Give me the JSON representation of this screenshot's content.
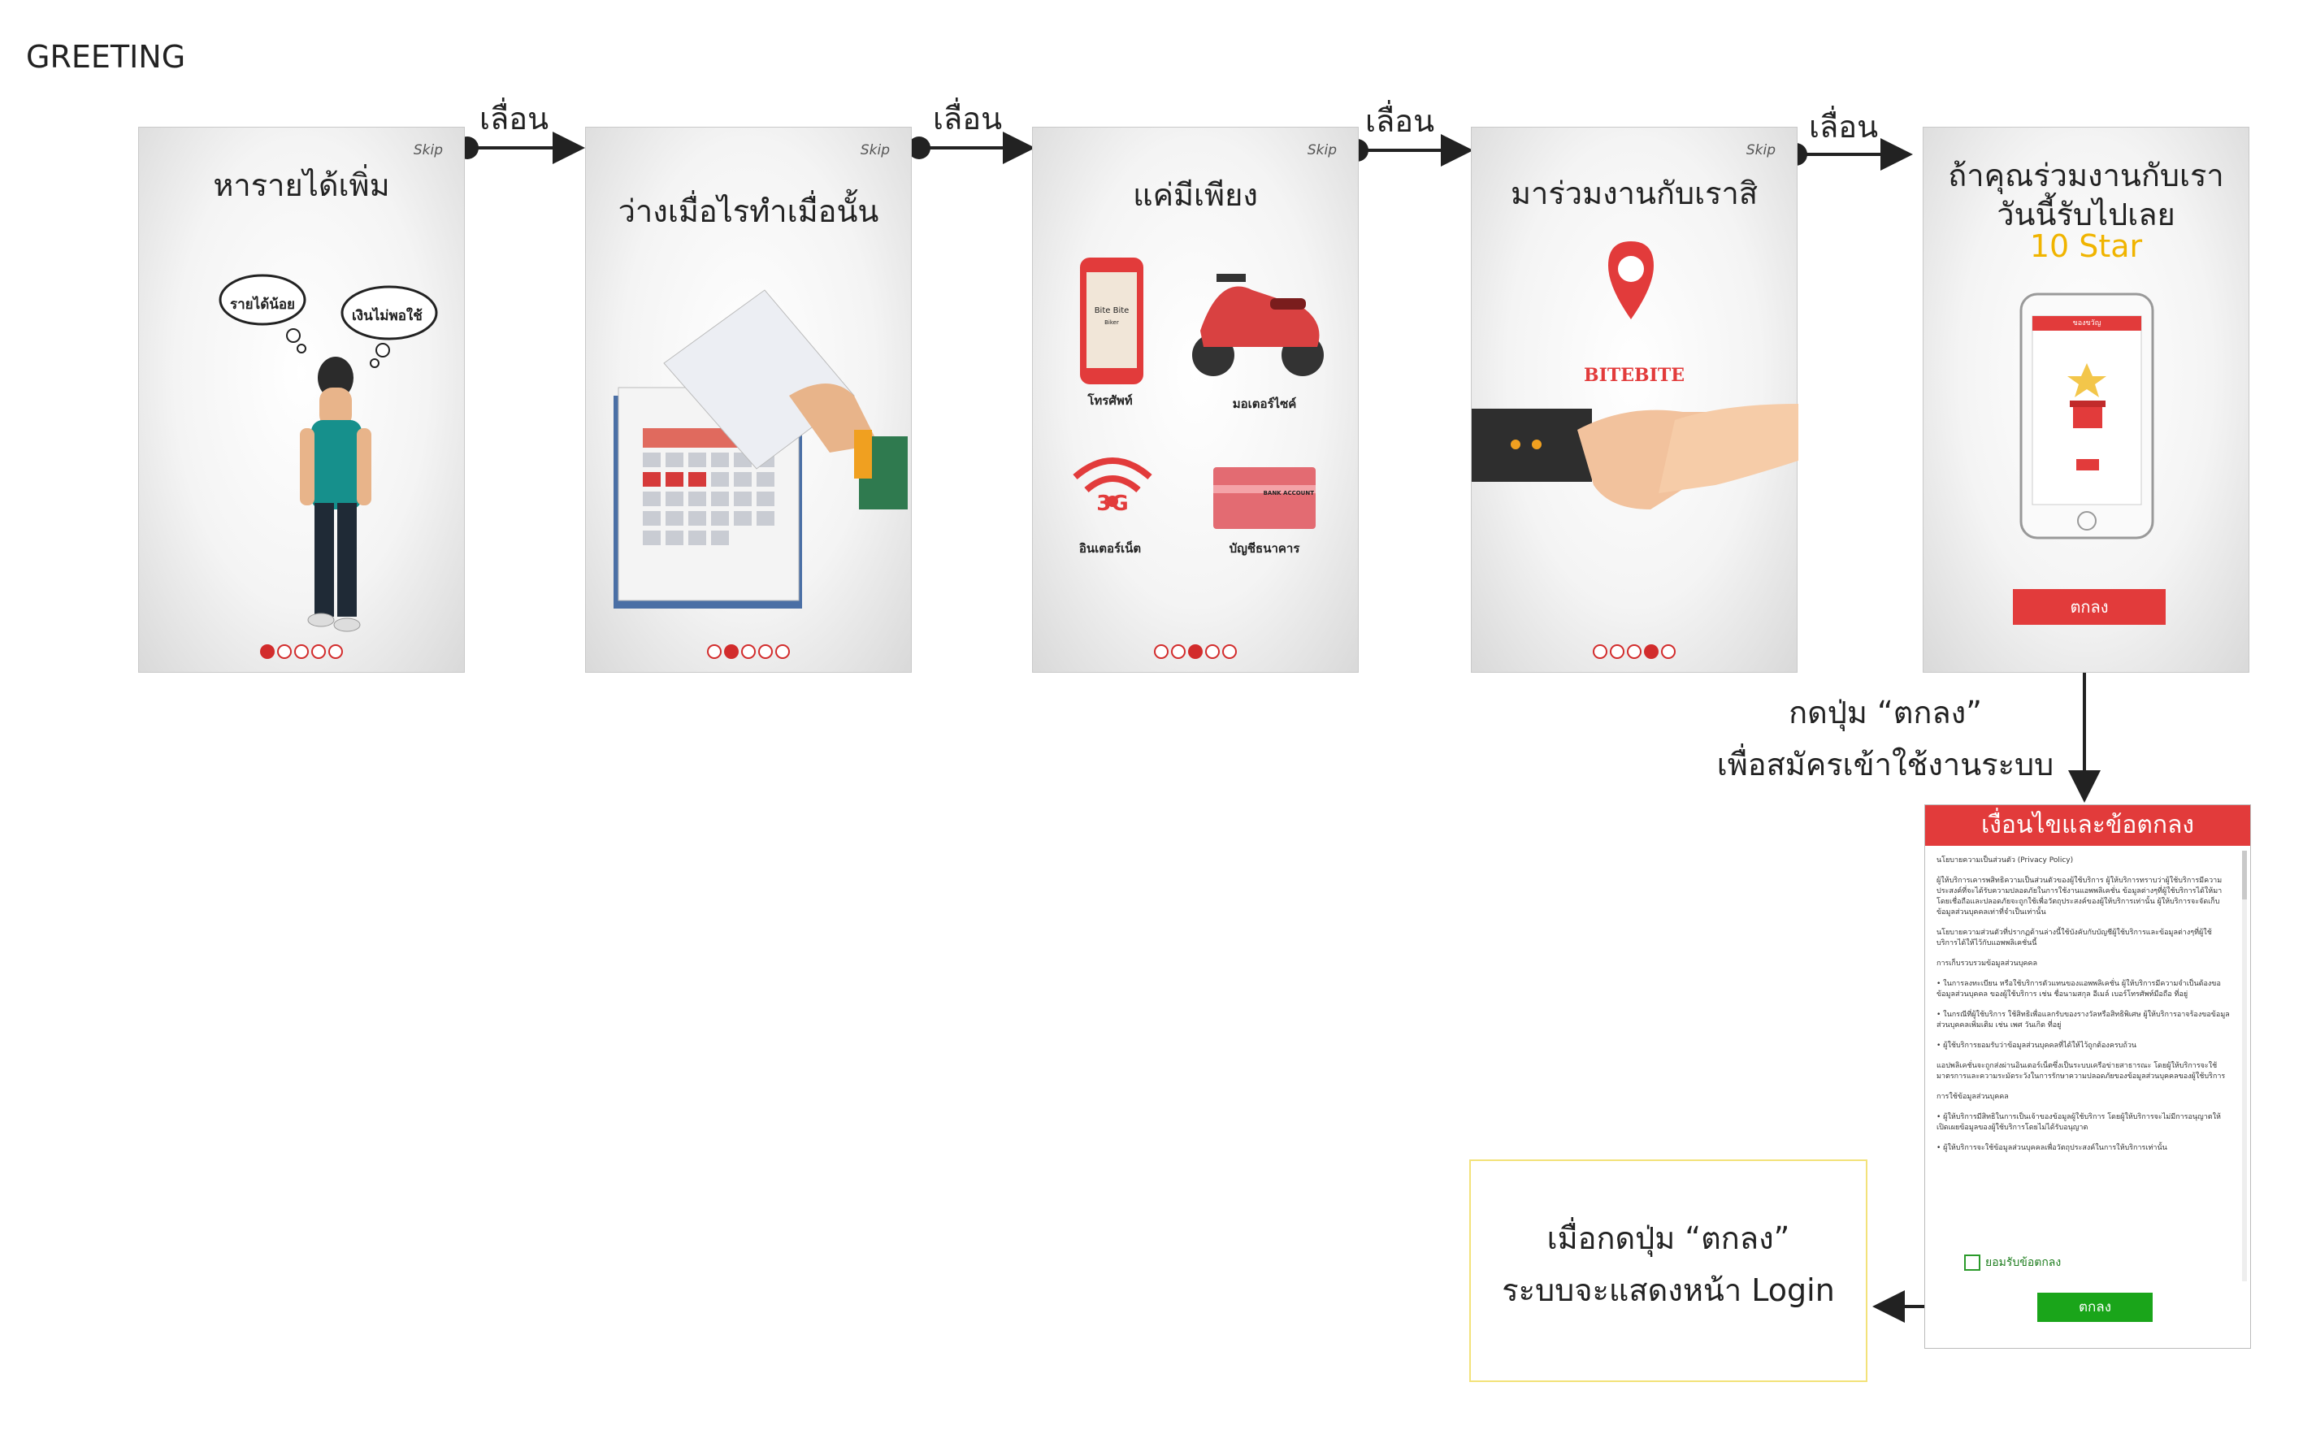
{
  "page_title": "GREETING",
  "swipe_label": "เลื่อน",
  "skip_label": "Skip",
  "screens": [
    {
      "title": "หารายได้เพิ่ม",
      "bubbles": [
        "รายได้น้อย",
        "เงินไม่พอใช้"
      ]
    },
    {
      "title": "ว่างเมื่อไรทำเมื่อนั้น"
    },
    {
      "title": "แค่มีเพียง",
      "items": [
        "โทรศัพท์",
        "มอเตอร์ไซค์",
        "อินเตอร์เน็ต",
        "บัญชีธนาคาร"
      ],
      "phone_text": "Bite Bite",
      "phone_sub": "Biker",
      "net_text": "3G",
      "bank_text": "BANK ACCOUNT"
    },
    {
      "title": "มาร่วมงานกับเราสิ",
      "logo": "BITEBITE"
    },
    {
      "title_line1": "ถ้าคุณร่วมงานกับเรา",
      "title_line2": "วันนี้รับไปเลย",
      "highlight": "10 Star",
      "phone_header": "ของขวัญ",
      "button": "ตกลง"
    }
  ],
  "annotation_register": [
    "กดปุ่ม “ตกลง”",
    "เพื่อสมัครเข้าใช้งานระบบ"
  ],
  "terms": {
    "header": "เงื่อนไขและข้อตกลง",
    "paragraphs": [
      "นโยบายความเป็นส่วนตัว (Privacy Policy)",
      "ผู้ให้บริการเคารพสิทธิความเป็นส่วนตัวของผู้ใช้บริการ ผู้ให้บริการทราบว่าผู้ใช้บริการมีความประสงค์ที่จะได้รับความปลอดภัยในการใช้งานแอพพลิเคชั่น ข้อมูลต่างๆที่ผู้ใช้บริการได้ให้มาโดยเชื่อถือและปลอดภัยจะถูกใช้เพื่อวัตถุประสงค์ของผู้ให้บริการเท่านั้น ผู้ให้บริการจะจัดเก็บข้อมูลส่วนบุคคลเท่าที่จำเป็นเท่านั้น",
      "นโยบายความส่วนตัวที่ปรากฏด้านล่างนี้ใช้บังคับกับบัญชีผู้ใช้บริการและข้อมูลต่างๆที่ผู้ใช้บริการได้ให้ไว้กับแอพพลิเคชั่นนี้",
      "การเก็บรวบรวมข้อมูลส่วนบุคคล",
      "•  ในการลงทะเบียน หรือใช้บริการตัวแทนของแอพพลิเคชั่น ผู้ให้บริการมีความจำเป็นต้องขอข้อมูลส่วนบุคคล ของผู้ใช้บริการ เช่น ชื่อนามสกุล อีเมล์ เบอร์โทรศัพท์มือถือ ที่อยู่",
      "•  ในกรณีที่ผู้ใช้บริการ ใช้สิทธิเพื่อแลกรับของรางวัลหรือสิทธิพิเศษ ผู้ให้บริการอาจร้องขอข้อมูลส่วนบุคคลเพิ่มเติม เช่น เพศ วันเกิด ที่อยู่",
      "•  ผู้ใช้บริการยอมรับว่าข้อมูลส่วนบุคคลที่ได้ให้ไว้ถูกต้องครบถ้วน",
      "แอปพลิเคชั่นจะถูกส่งผ่านอินเตอร์เน็ตซึ่งเป็นระบบเครือข่ายสาธารณะ โดยผู้ให้บริการจะใช้มาตรการและความระมัดระวังในการรักษาความปลอดภัยของข้อมูลส่วนบุคคลของผู้ใช้บริการ",
      "การใช้ข้อมูลส่วนบุคคล",
      "•  ผู้ให้บริการมีสิทธิในการเป็นเจ้าของข้อมูลผู้ใช้บริการ โดยผู้ให้บริการจะไม่มีการอนุญาตให้เปิดเผยข้อมูลของผู้ใช้บริการโดยไม่ได้รับอนุญาต",
      "•  ผู้ให้บริการจะใช้ข้อมูลส่วนบุคคลเพื่อวัตถุประสงค์ในการให้บริการเท่านั้น"
    ],
    "checkbox_label": "ยอมรับข้อตกลง",
    "button": "ตกลง"
  },
  "note": [
    "เมื่อกดปุ่ม “ตกลง”",
    "ระบบจะแสดงหน้า Login"
  ]
}
